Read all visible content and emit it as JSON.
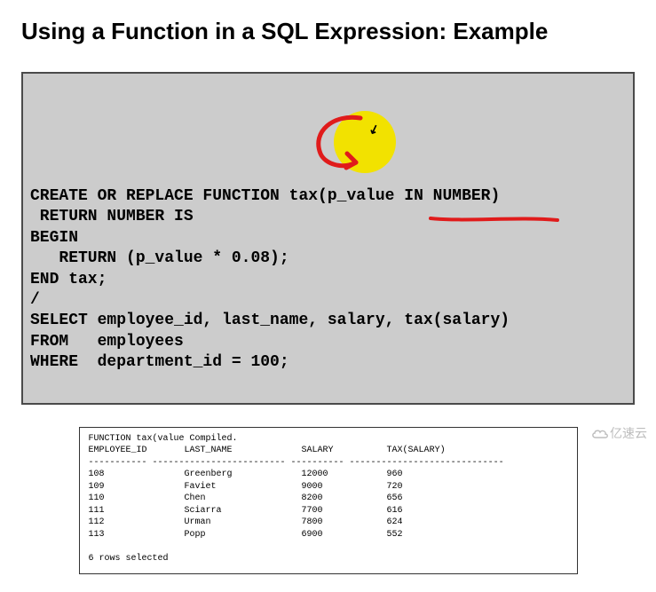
{
  "title": "Using a Function in a SQL Expression: Example",
  "code": {
    "line1": "CREATE OR REPLACE FUNCTION tax(p_value IN NUMBER)",
    "line2": " RETURN NUMBER IS",
    "line3": "BEGIN",
    "line4": "   RETURN (p_value * 0.08);",
    "line5": "END tax;",
    "line6": "/",
    "line7": "SELECT employee_id, last_name, salary, tax(salary)",
    "line8": "FROM   employees",
    "line9": "WHERE  department_id = 100;"
  },
  "output": {
    "header_line": "FUNCTION tax(value Compiled.",
    "col1": "EMPLOYEE_ID",
    "col2": "LAST_NAME",
    "col3": "SALARY",
    "col4": "TAX(SALARY)",
    "sep": "----------- ------------------------- ---------- -----------------------------",
    "rows": [
      {
        "c1": "108",
        "c2": "Greenberg",
        "c3": "12000",
        "c4": "960"
      },
      {
        "c1": "109",
        "c2": "Faviet",
        "c3": "9000",
        "c4": "720"
      },
      {
        "c1": "110",
        "c2": "Chen",
        "c3": "8200",
        "c4": "656"
      },
      {
        "c1": "111",
        "c2": "Sciarra",
        "c3": "7700",
        "c4": "616"
      },
      {
        "c1": "112",
        "c2": "Urman",
        "c3": "7800",
        "c4": "624"
      },
      {
        "c1": "113",
        "c2": "Popp",
        "c3": "6900",
        "c4": "552"
      }
    ],
    "footer": "6 rows selected"
  },
  "watermark": "亿速云"
}
